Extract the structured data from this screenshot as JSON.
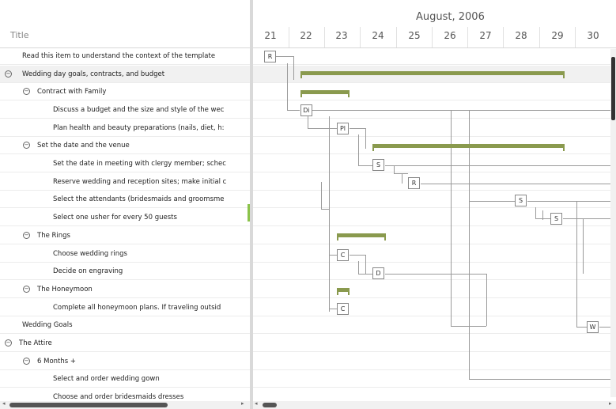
{
  "tree": {
    "title": "Title",
    "rows": [
      {
        "label": "Read this item to understand the context of the template"
      },
      {
        "label": "Wedding day goals, contracts, and budget",
        "toggle": "−"
      },
      {
        "label": "Contract with Family",
        "toggle": "−"
      },
      {
        "label": "Discuss a budget and the size and style of the wec"
      },
      {
        "label": "Plan health and beauty preparations (nails, diet, h:"
      },
      {
        "label": "Set the date and the venue",
        "toggle": "−"
      },
      {
        "label": "Set the date in meeting with clergy member; schec"
      },
      {
        "label": "Reserve wedding and reception sites; make initial c"
      },
      {
        "label": "Select the attendants (bridesmaids and groomsme"
      },
      {
        "label": "Select one usher for every 50 guests"
      },
      {
        "label": "The Rings",
        "toggle": "−"
      },
      {
        "label": "Choose wedding rings"
      },
      {
        "label": "Decide on engraving"
      },
      {
        "label": "The Honeymoon",
        "toggle": "−"
      },
      {
        "label": "Complete all honeymoon plans. If traveling outsid"
      },
      {
        "label": "Wedding Goals"
      },
      {
        "label": "The Attire",
        "toggle": "−"
      },
      {
        "label": "6 Months +",
        "toggle": "−"
      },
      {
        "label": "Select and order wedding gown"
      },
      {
        "label": "Choose and order bridesmaids dresses"
      }
    ]
  },
  "gantt": {
    "month": "August, 2006",
    "days": [
      "21",
      "22",
      "23",
      "24",
      "25",
      "26",
      "27",
      "28",
      "29",
      "30"
    ],
    "tasks": [
      "R",
      "Di",
      "Pl",
      "S",
      "R",
      "S",
      "S",
      "C",
      "D",
      "C",
      "W"
    ]
  },
  "colors": {
    "summary_bar": "#8a9a4e",
    "selection": "#f1f1f1",
    "gridline": "#ececec"
  }
}
